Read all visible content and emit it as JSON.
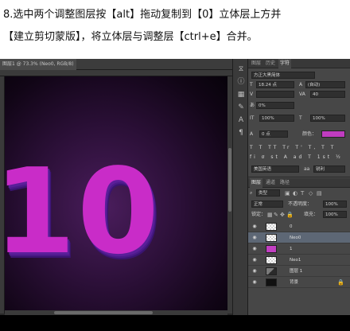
{
  "instructions": {
    "line1": "8.选中两个调整图层按【alt】拖动复制到【0】立体层上方并",
    "line2": "【建立剪切蒙版】，将立体层与调整层【ctrl+e】合并。"
  },
  "document": {
    "tab_title": "图层1 @ 73.3% (Neo0, RGB/8)",
    "canvas_text": "10",
    "text_color": "#c92cc8"
  },
  "character_panel": {
    "tabs": [
      "图层",
      "历史",
      "字符"
    ],
    "active_tab": "字符",
    "font_family": "方正大黑简体",
    "font_size": "18.24 点",
    "leading": "(自动)",
    "tracking": "40",
    "kerning": "0%",
    "vertical_scale": "100%",
    "horizontal_scale": "100%",
    "baseline_shift": "0 点",
    "color_label": "颜色：",
    "color_value": "#c03cc0",
    "style_buttons": "T T TT Tr T' T, T T",
    "opentype_buttons": "fi σ st A ad T 1st ½",
    "language": "美国英语",
    "antialias": "锐利"
  },
  "layers_panel": {
    "tabs": [
      "图层",
      "通道",
      "路径"
    ],
    "kind_filter": "类型",
    "blend_mode": "正常",
    "opacity_label": "不透明度：",
    "opacity": "100%",
    "lock_label": "锁定：",
    "fill_label": "填充：",
    "fill": "100%",
    "layers": [
      {
        "name": "0",
        "thumb": "checker",
        "selected": false,
        "clipped": false,
        "mask": true
      },
      {
        "name": "Neo0",
        "thumb": "checker",
        "selected": true,
        "clipped": false,
        "mask": false
      },
      {
        "name": "1",
        "thumb": "purple",
        "selected": false,
        "clipped": false,
        "mask": false
      },
      {
        "name": "Neo1",
        "thumb": "checker",
        "selected": false,
        "clipped": false,
        "mask": false
      },
      {
        "name": "图层 1",
        "thumb": "checker",
        "selected": false,
        "clipped": false,
        "mask": false
      },
      {
        "name": "背景",
        "thumb": "solid",
        "selected": false,
        "clipped": false,
        "mask": false
      }
    ]
  }
}
